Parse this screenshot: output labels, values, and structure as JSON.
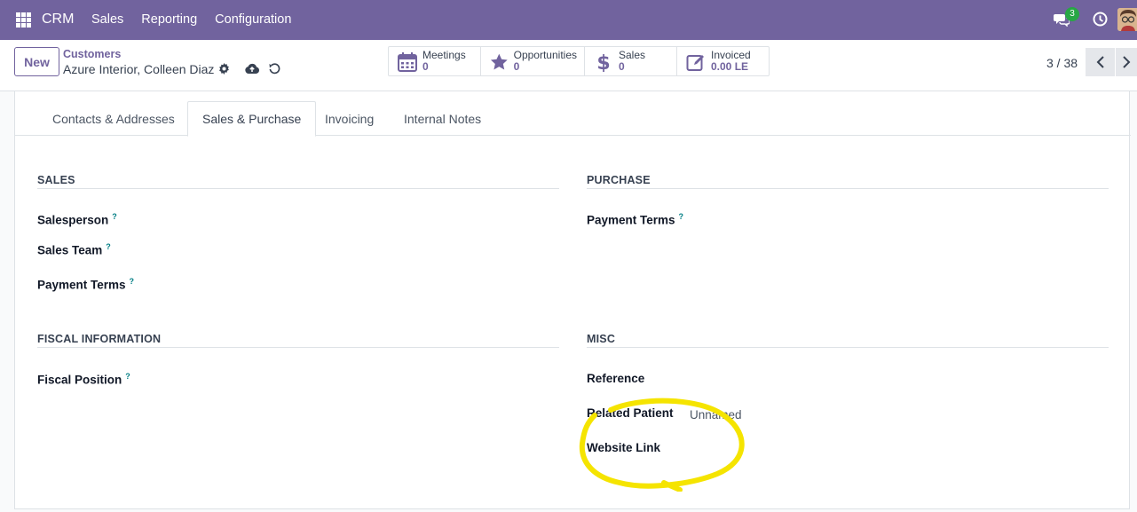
{
  "navbar": {
    "brand": "CRM",
    "menu": [
      "Sales",
      "Reporting",
      "Configuration"
    ],
    "chat_badge": "3",
    "accent": "#71639e"
  },
  "control": {
    "new_label": "New",
    "breadcrumb": "Customers",
    "record_name": "Azure Interior, Colleen Diaz",
    "stats": [
      {
        "icon": "calendar-icon",
        "label": "Meetings",
        "value": "0"
      },
      {
        "icon": "star-icon",
        "label": "Opportunities",
        "value": "0"
      },
      {
        "icon": "dollar-icon",
        "label": "Sales",
        "value": "0"
      },
      {
        "icon": "invoice-icon",
        "label": "Invoiced",
        "value": "0.00 LE"
      }
    ],
    "pager": "3 / 38"
  },
  "tabs": [
    "Contacts & Addresses",
    "Sales & Purchase",
    "Invoicing",
    "Internal Notes"
  ],
  "sections": {
    "sales": {
      "title": "SALES",
      "fields": [
        "Salesperson",
        "Sales Team",
        "Payment Terms"
      ]
    },
    "purchase": {
      "title": "PURCHASE",
      "fields": [
        "Payment Terms"
      ]
    },
    "fiscal": {
      "title": "FISCAL INFORMATION",
      "fields": [
        "Fiscal Position"
      ]
    },
    "misc": {
      "title": "MISC",
      "reference": "Reference",
      "related_patient": "Related Patient",
      "related_patient_value": "Unnamed",
      "website_link": "Website Link"
    }
  },
  "help_mark": "?",
  "highlight_color": "#f5e400"
}
